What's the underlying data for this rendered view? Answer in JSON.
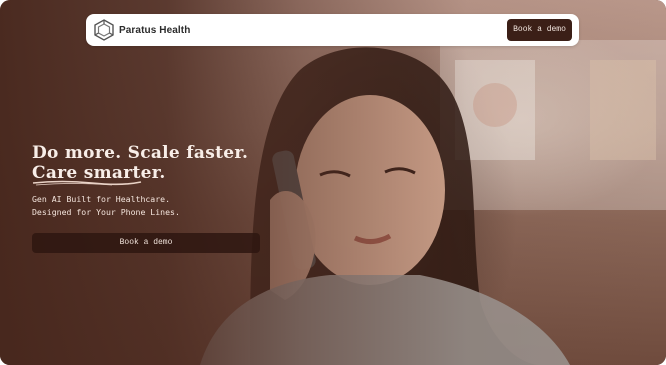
{
  "brand": {
    "name": "Paratus Health",
    "logo_icon": "hexagon-logo-icon"
  },
  "nav": {
    "cta_label": "Book a demo"
  },
  "hero": {
    "headline_line1": "Do more. Scale faster.",
    "headline_line2": "Care smarter.",
    "subline1": "Gen AI Built for Healthcare.",
    "subline2": "Designed for Your Phone Lines.",
    "cta_label": "Book a demo"
  },
  "colors": {
    "brand_dark": "#3b1f17",
    "hero_text": "#f8eee8",
    "underline_accent": "#e9d2c6"
  }
}
